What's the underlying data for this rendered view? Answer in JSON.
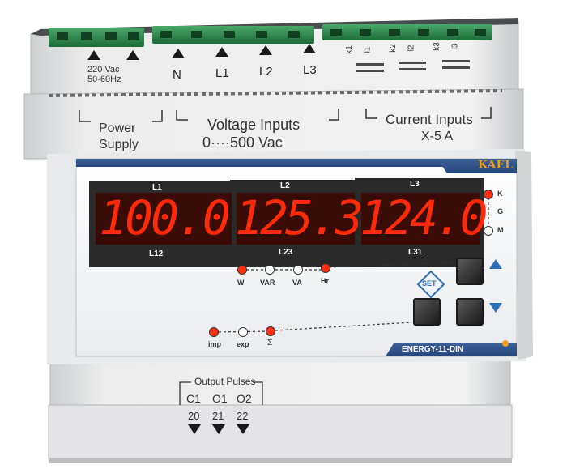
{
  "device": {
    "brand": "KAEL",
    "model": "ENERGY-11-DIN",
    "colors": {
      "led_red": "#ff3010",
      "panel": "#2e4f86",
      "display_bg": "#2a2a2a",
      "digit": "#ff2a0a",
      "orange_dot": "#f0a020"
    }
  },
  "terminals_top": {
    "supply": {
      "line1": "220 Vac",
      "line2": "50-60Hz"
    },
    "labels": [
      "N",
      "L1",
      "L2",
      "L3"
    ],
    "ct": [
      "k1",
      "l1",
      "k2",
      "l2",
      "k3",
      "l3"
    ]
  },
  "sections": {
    "power": {
      "line1": "Power",
      "line2": "Supply"
    },
    "voltage": {
      "line1": "Voltage Inputs",
      "line2": "0····500 Vac"
    },
    "current": {
      "line1": "Current Inputs",
      "line2": "X-5 A"
    }
  },
  "displays": [
    {
      "top_label": "L1",
      "value": "100.0",
      "bottom_label": "L12"
    },
    {
      "top_label": "L2",
      "value": "125.3",
      "bottom_label": "L23"
    },
    {
      "top_label": "L3",
      "value": "124.0",
      "bottom_label": "L31"
    }
  ],
  "multiplier_indicators": [
    {
      "label": "K",
      "state": "on"
    },
    {
      "label": "G",
      "state": "none"
    },
    {
      "label": "M",
      "state": "off"
    }
  ],
  "unit_indicators": [
    {
      "label": "W",
      "state": "on"
    },
    {
      "label": "VAR",
      "state": "off"
    },
    {
      "label": "VA",
      "state": "off"
    },
    {
      "label": "Hr",
      "state": "on"
    }
  ],
  "energy_indicators": [
    {
      "label": "imp",
      "state": "on"
    },
    {
      "label": "exp",
      "state": "off"
    },
    {
      "label": "Σ",
      "state": "on"
    }
  ],
  "buttons": {
    "set_label": "SET"
  },
  "output_pulses": {
    "title": "Output Pulses",
    "labels": [
      "C1",
      "O1",
      "O2"
    ],
    "numbers": [
      "20",
      "21",
      "22"
    ]
  }
}
